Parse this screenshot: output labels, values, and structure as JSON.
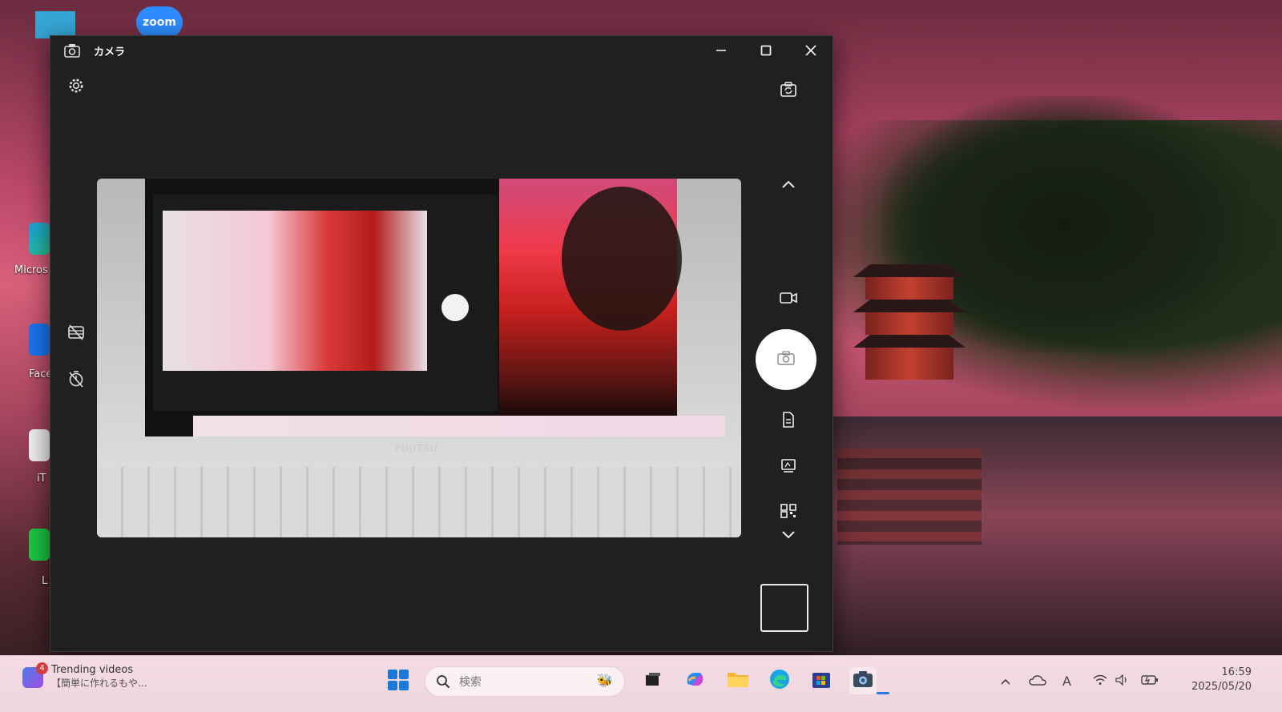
{
  "window": {
    "title": "カメラ",
    "controls": {
      "minimize": "─",
      "maximize": "☐",
      "close": "✕"
    }
  },
  "preview": {
    "brand": "FUJITSU"
  },
  "desktop": {
    "icons": [
      {
        "name": "zoom",
        "label": "zoom"
      },
      {
        "name": "microsoft-edge",
        "label": "Micros"
      },
      {
        "name": "facebook",
        "label": "Face"
      },
      {
        "name": "itunes",
        "label": "iT"
      },
      {
        "name": "line",
        "label": "L"
      }
    ]
  },
  "taskbar": {
    "widget": {
      "badge": "4",
      "title": "Trending videos",
      "subtitle": "【簡単に作れるもや..."
    },
    "search": {
      "placeholder": "検索"
    },
    "clock": {
      "time": "16:59",
      "date": "2025/05/20"
    },
    "ime": "A"
  },
  "colors": {
    "window_bg": "#202020",
    "taskbar_bg": "#f4dbe4",
    "accent": "#2b7adf"
  }
}
